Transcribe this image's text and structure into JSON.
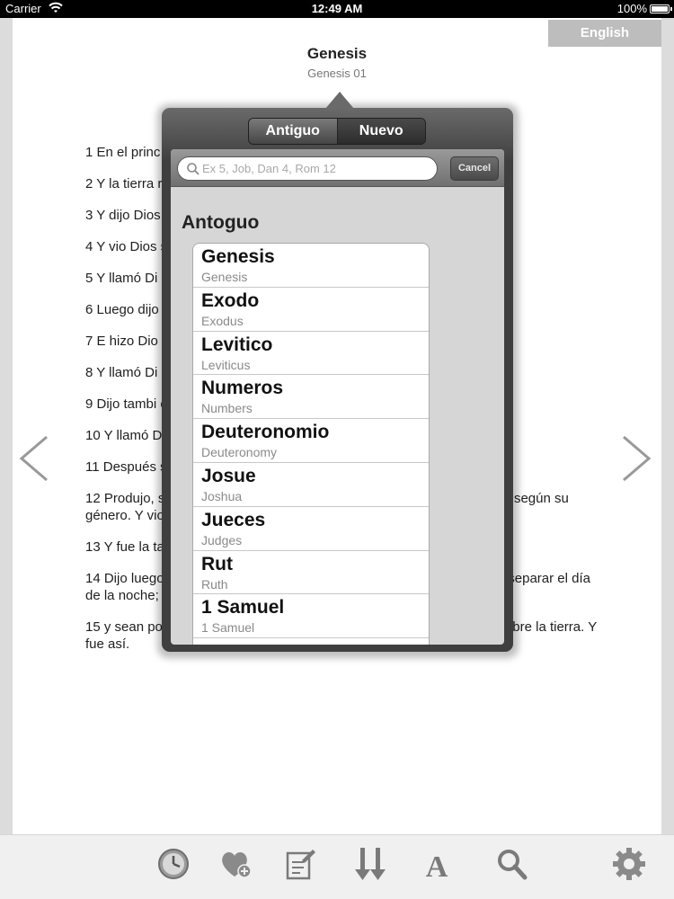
{
  "status_bar": {
    "carrier": "Carrier",
    "time": "12:49 AM",
    "battery": "100%"
  },
  "language_button": "English",
  "reader": {
    "book_title": "Genesis",
    "chapter_label": "Genesis 01",
    "verses": [
      "1 En el princ",
      "2 Y la tierra                                                                          re la faz del abismo, y el",
      "3 Y dijo Dios",
      "4 Y vio Dios                                                                              s.",
      "5 Y llamó Di                                                                       de y la mañana un",
      "6 Luego dijo                                                                      las aguas de las aguas",
      "7 E hizo Dio                                                                       de la expansión,",
      "8 Y llamó Di                                                                       ía segundo.",
      "9 Dijo tambi                                                                       os en un lugar, y desc",
      "10 Y llamó D                                                                     ares. Y vio Dios que era",
      "11 Después                                                                        semilla; árbol de frut                                                                       , sobre la tierra. Y fue",
      "12 Produjo,                                                                           su naturaleza, y árbol que da fruto, cuya semilla está en él, según su género. Y vio Dios que era bueno.",
      "13 Y fue la tarde y la mañana el día tercero.",
      "14 Dijo luego Dios: Haya lumbreras en la expansión de los cielos para separar el día de la noche; y sirvan de señales para las estaciones, para días y años,",
      "15 y sean por lumbreras en la expansión de los cielos para alumbrar sobre la tierra. Y fue así."
    ]
  },
  "popover": {
    "segments": [
      "Antiguo",
      "Nuevo"
    ],
    "search_placeholder": "Ex 5, Job, Dan 4, Rom 12",
    "cancel_label": "Cancel",
    "section_header": "Antoguo",
    "books": [
      {
        "name": "Genesis",
        "english": "Genesis"
      },
      {
        "name": "Exodo",
        "english": "Exodus"
      },
      {
        "name": "Levitico",
        "english": "Leviticus"
      },
      {
        "name": "Numeros",
        "english": "Numbers"
      },
      {
        "name": "Deuteronomio",
        "english": "Deuteronomy"
      },
      {
        "name": "Josue",
        "english": "Joshua"
      },
      {
        "name": "Jueces",
        "english": "Judges"
      },
      {
        "name": "Rut",
        "english": "Ruth"
      },
      {
        "name": "1 Samuel",
        "english": "1 Samuel"
      }
    ]
  },
  "toolbar_icons": [
    "history-clock-icon",
    "favorite-add-icon",
    "note-edit-icon",
    "scroll-down-icon",
    "font-size-icon",
    "search-icon",
    "settings-gear-icon"
  ]
}
